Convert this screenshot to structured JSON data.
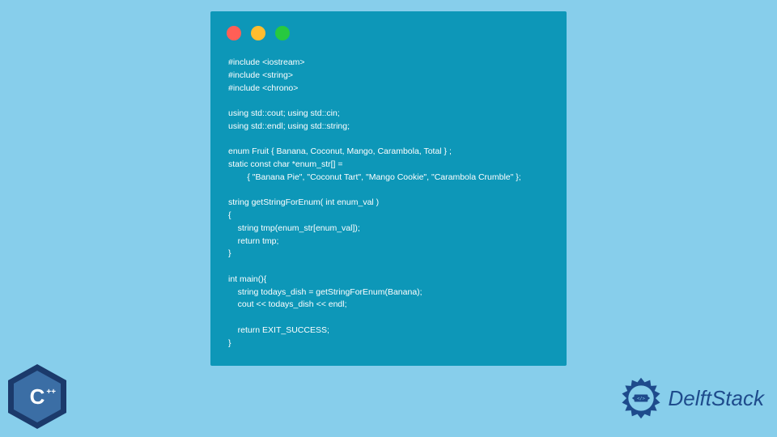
{
  "code": {
    "lines": [
      "#include <iostream>",
      "#include <string>",
      "#include <chrono>",
      "",
      "using std::cout; using std::cin;",
      "using std::endl; using std::string;",
      "",
      "enum Fruit { Banana, Coconut, Mango, Carambola, Total } ;",
      "static const char *enum_str[] =",
      "        { \"Banana Pie\", \"Coconut Tart\", \"Mango Cookie\", \"Carambola Crumble\" };",
      "",
      "string getStringForEnum( int enum_val )",
      "{",
      "    string tmp(enum_str[enum_val]);",
      "    return tmp;",
      "}",
      "",
      "int main(){",
      "    string todays_dish = getStringForEnum(Banana);",
      "    cout << todays_dish << endl;",
      "",
      "    return EXIT_SUCCESS;",
      "}"
    ]
  },
  "badges": {
    "cpp_letter": "C",
    "cpp_plus": "++"
  },
  "brand": {
    "name": "DelftStack"
  }
}
